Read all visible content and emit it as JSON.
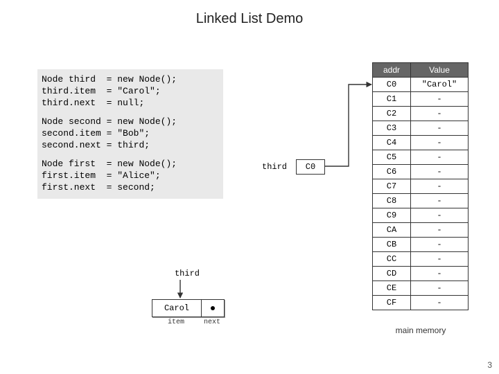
{
  "title": "Linked List Demo",
  "code": {
    "third": {
      "name": "Node third",
      "item": "third.item",
      "next": "third.next",
      "rhs_new": "new Node();",
      "rhs_item": "\"Carol\";",
      "rhs_next": "null;"
    },
    "second": {
      "name": "Node second",
      "item": "second.item",
      "next": "second.next",
      "rhs_new": "new Node();",
      "rhs_item": "\"Bob\";",
      "rhs_next": "third;"
    },
    "first": {
      "name": "Node first",
      "item": "first.item",
      "next": "first.next",
      "rhs_new": "new Node();",
      "rhs_item": "\"Alice\";",
      "rhs_next": "second;"
    }
  },
  "memory": {
    "headers": {
      "addr": "addr",
      "value": "Value"
    },
    "rows": [
      {
        "addr": "C0",
        "value": "\"Carol\""
      },
      {
        "addr": "C1",
        "value": "-"
      },
      {
        "addr": "C2",
        "value": "-"
      },
      {
        "addr": "C3",
        "value": "-"
      },
      {
        "addr": "C4",
        "value": "-"
      },
      {
        "addr": "C5",
        "value": "-"
      },
      {
        "addr": "C6",
        "value": "-"
      },
      {
        "addr": "C7",
        "value": "-"
      },
      {
        "addr": "C8",
        "value": "-"
      },
      {
        "addr": "C9",
        "value": "-"
      },
      {
        "addr": "CA",
        "value": "-"
      },
      {
        "addr": "CB",
        "value": "-"
      },
      {
        "addr": "CC",
        "value": "-"
      },
      {
        "addr": "CD",
        "value": "-"
      },
      {
        "addr": "CE",
        "value": "-"
      },
      {
        "addr": "CF",
        "value": "-"
      }
    ],
    "caption": "main memory"
  },
  "pointer": {
    "label": "third",
    "value": "C0"
  },
  "node": {
    "label": "third",
    "item_value": "Carol",
    "fields": {
      "item": "item",
      "next": "next"
    }
  },
  "page_number": "3",
  "chart_data": {
    "type": "table",
    "title": "Linked List Demo — memory state after constructing third node",
    "columns": [
      "addr",
      "Value"
    ],
    "rows": [
      [
        "C0",
        "\"Carol\""
      ],
      [
        "C1",
        "-"
      ],
      [
        "C2",
        "-"
      ],
      [
        "C3",
        "-"
      ],
      [
        "C4",
        "-"
      ],
      [
        "C5",
        "-"
      ],
      [
        "C6",
        "-"
      ],
      [
        "C7",
        "-"
      ],
      [
        "C8",
        "-"
      ],
      [
        "C9",
        "-"
      ],
      [
        "CA",
        "-"
      ],
      [
        "CB",
        "-"
      ],
      [
        "CC",
        "-"
      ],
      [
        "CD",
        "-"
      ],
      [
        "CE",
        "-"
      ],
      [
        "CF",
        "-"
      ]
    ],
    "pointers": {
      "third": "C0"
    },
    "node_box": {
      "name": "third",
      "item": "Carol",
      "next": null
    }
  }
}
